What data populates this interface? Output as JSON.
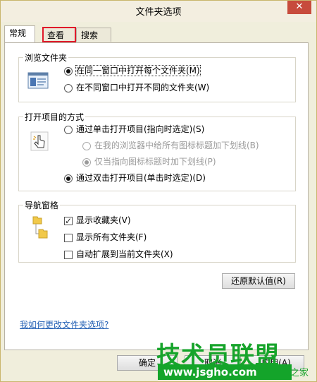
{
  "window": {
    "title": "文件夹选项",
    "close_glyph": "✕"
  },
  "tabs": [
    {
      "label": "常规",
      "active": true
    },
    {
      "label": "查看",
      "active": false,
      "highlighted": true
    },
    {
      "label": "搜索",
      "active": false
    }
  ],
  "browse_group": {
    "label": "浏览文件夹",
    "options": [
      {
        "label": "在同一窗口中打开每个文件夹(M)",
        "selected": true
      },
      {
        "label": "在不同窗口中打开不同的文件夹(W)",
        "selected": false
      }
    ]
  },
  "click_group": {
    "label": "打开项目的方式",
    "options": [
      {
        "label": "通过单击打开项目(指向时选定)(S)",
        "selected": false
      },
      {
        "label": "在我的浏览器中给所有图标标题加下划线(B)",
        "selected": false,
        "disabled": true
      },
      {
        "label": "仅当指向图标标题时加下划线(P)",
        "selected": true,
        "disabled": true
      },
      {
        "label": "通过双击打开项目(单击时选定)(D)",
        "selected": true
      }
    ]
  },
  "nav_group": {
    "label": "导航窗格",
    "options": [
      {
        "label": "显示收藏夹(V)",
        "checked": true
      },
      {
        "label": "显示所有文件夹(F)",
        "checked": false
      },
      {
        "label": "自动扩展到当前文件夹(X)",
        "checked": false
      }
    ]
  },
  "restore_defaults_label": "还原默认值(R)",
  "help_link": "我如何更改文件夹选项?",
  "footer": {
    "ok_label": "确定",
    "cancel_label": "取消",
    "apply_label": "应用(A)"
  },
  "watermark": {
    "title": "技术员联盟",
    "url": "www.jsgho.com",
    "suffix": "之家"
  }
}
